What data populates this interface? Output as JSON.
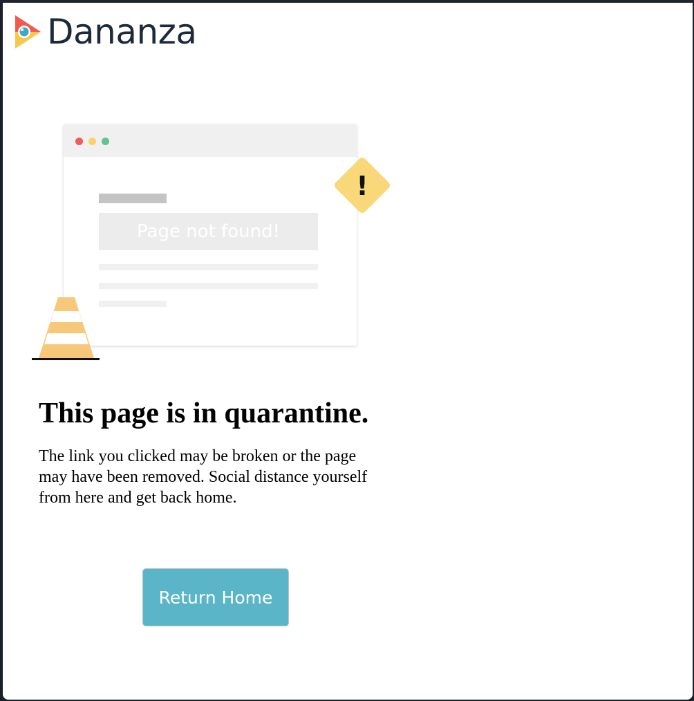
{
  "brand": {
    "name": "Dananza",
    "colors": {
      "red": "#f15b4f",
      "yellow": "#f8c84a",
      "blue": "#3fa9c5",
      "text": "#1d2a3a"
    }
  },
  "illustration": {
    "window_dots": [
      "red",
      "yellow",
      "green"
    ],
    "notfound_text": "Page not found!",
    "warning_icon": "warning-diamond-icon",
    "warning_symbol": "!",
    "cone_icon": "traffic-cone-icon"
  },
  "content": {
    "headline": "This page is in quarantine.",
    "body": "The link you clicked may be broken or the page may have been removed. Social distance yourself from here and get back home."
  },
  "actions": {
    "return_home_label": "Return Home",
    "button_color": "#5bb5c8"
  }
}
